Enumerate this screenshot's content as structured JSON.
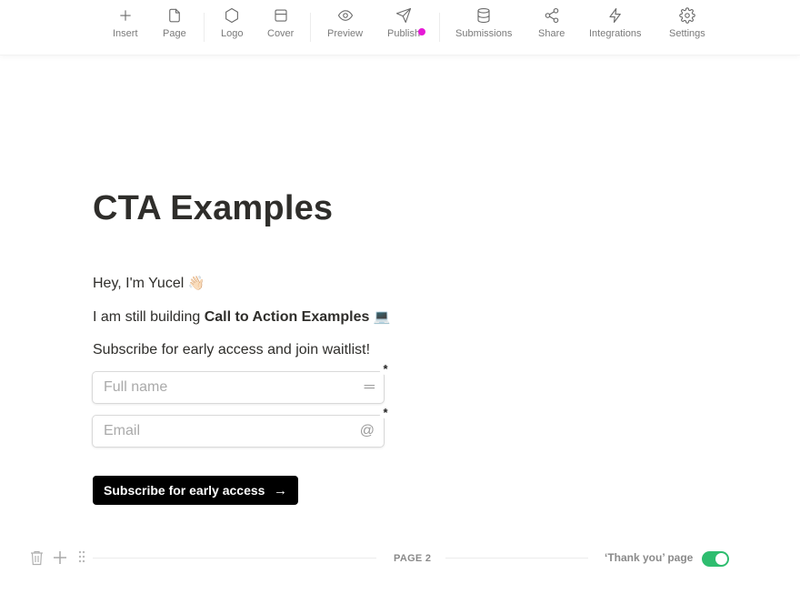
{
  "toolbar": {
    "items": [
      {
        "label": "Insert",
        "icon": "plus-icon"
      },
      {
        "label": "Page",
        "icon": "page-icon"
      },
      {
        "label": "Logo",
        "icon": "hexagon-icon"
      },
      {
        "label": "Cover",
        "icon": "cover-icon"
      },
      {
        "label": "Preview",
        "icon": "eye-icon"
      },
      {
        "label": "Publish",
        "icon": "send-icon"
      },
      {
        "label": "Submissions",
        "icon": "database-icon"
      },
      {
        "label": "Share",
        "icon": "share-icon"
      },
      {
        "label": "Integrations",
        "icon": "lightning-icon"
      },
      {
        "label": "Settings",
        "icon": "gear-icon"
      }
    ],
    "publish_dot_color": "#e619d6"
  },
  "page": {
    "title": "CTA Examples",
    "greeting": "Hey, I'm Yucel",
    "greeting_emoji": "👋🏻",
    "building_prefix": "I am still building ",
    "building_bold": "Call to Action Examples",
    "building_emoji": "💻",
    "subscribe_text": "Subscribe for early access and join waitlist!"
  },
  "form": {
    "fields": [
      {
        "placeholder": "Full name",
        "value": "",
        "icon": "short-text-icon",
        "icon_glyph": "═",
        "required": "*"
      },
      {
        "placeholder": "Email",
        "value": "",
        "icon": "at-sign-icon",
        "icon_glyph": "@",
        "required": "*"
      }
    ],
    "submit_label": "Subscribe for early access",
    "submit_arrow": "→"
  },
  "page_break": {
    "label": "PAGE 2",
    "thank_you_label": "‘Thank you’ page",
    "thank_you_enabled": true,
    "toggle_color": "#2ebd6f"
  }
}
